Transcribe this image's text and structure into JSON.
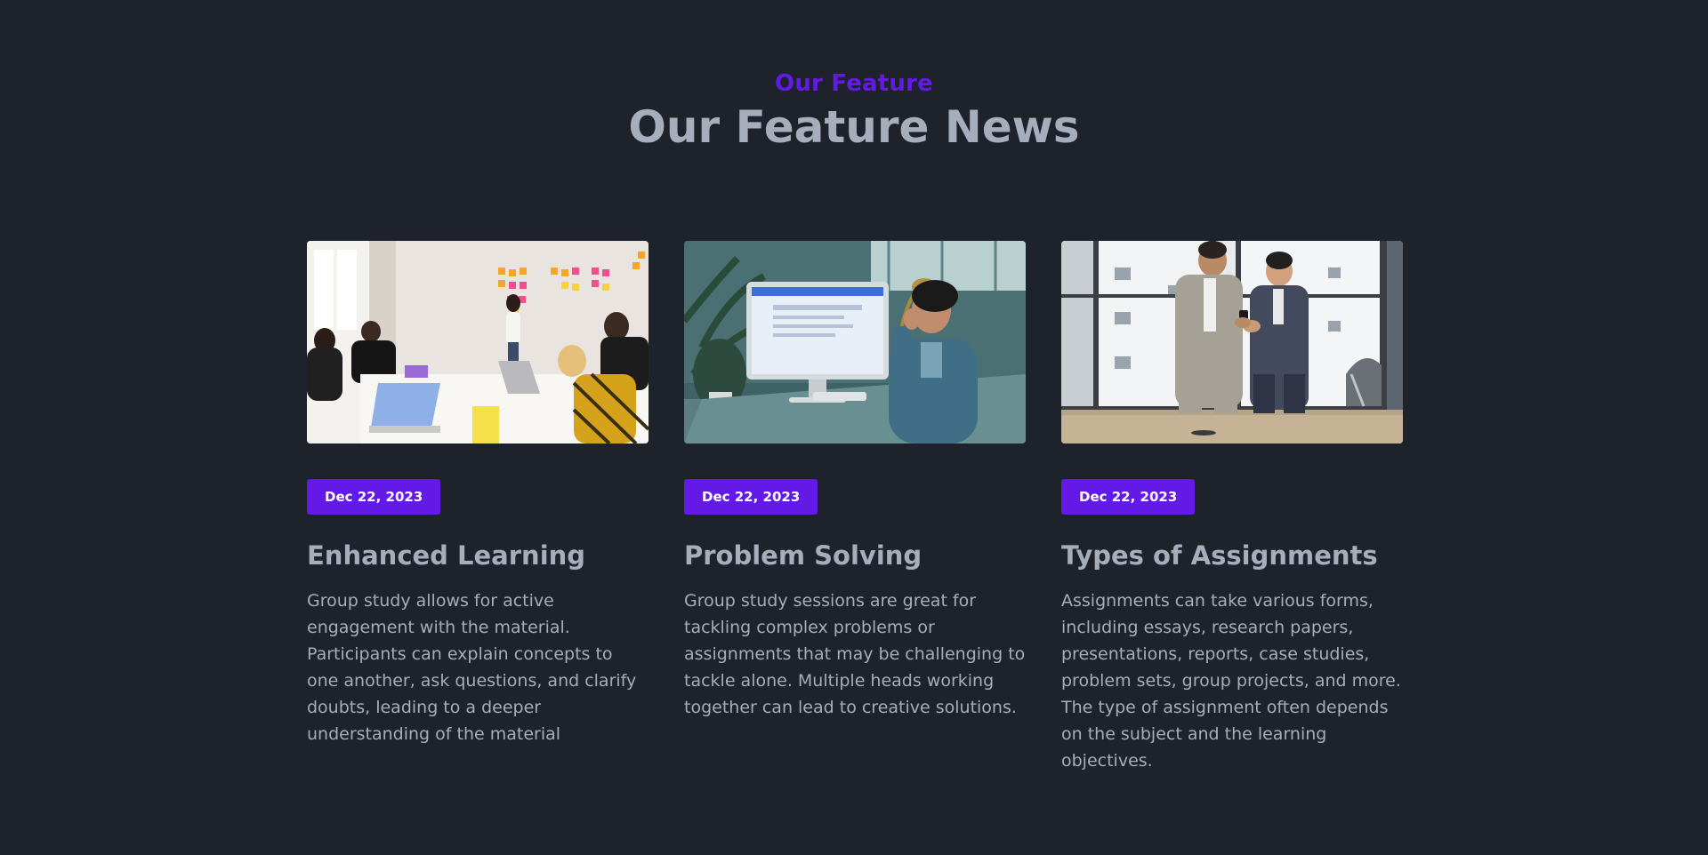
{
  "section": {
    "eyebrow": "Our Feature",
    "title": "Our Feature News"
  },
  "colors": {
    "background": "#1d222b",
    "accent": "#641ae6",
    "text": "#a6adbb"
  },
  "cards": [
    {
      "image": "team-meeting-sticky-notes-photo",
      "date": "Dec 22, 2023",
      "title": "Enhanced Learning",
      "text": "Group study allows for active engagement with the material. Participants can explain concepts to one another, ask questions, and clarify doubts, leading to a deeper understanding of the material"
    },
    {
      "image": "man-at-desk-on-phone-photo",
      "date": "Dec 22, 2023",
      "title": "Problem Solving",
      "text": "Group study sessions are great for tackling complex problems or assignments that may be challenging to tackle alone. Multiple heads working together can lead to creative solutions."
    },
    {
      "image": "two-businessmen-with-phone-photo",
      "date": "Dec 22, 2023",
      "title": "Types of Assignments",
      "text": "Assignments can take various forms, including essays, research papers, presentations, reports, case studies, problem sets, group projects, and more. The type of assignment often depends on the subject and the learning objectives."
    }
  ]
}
